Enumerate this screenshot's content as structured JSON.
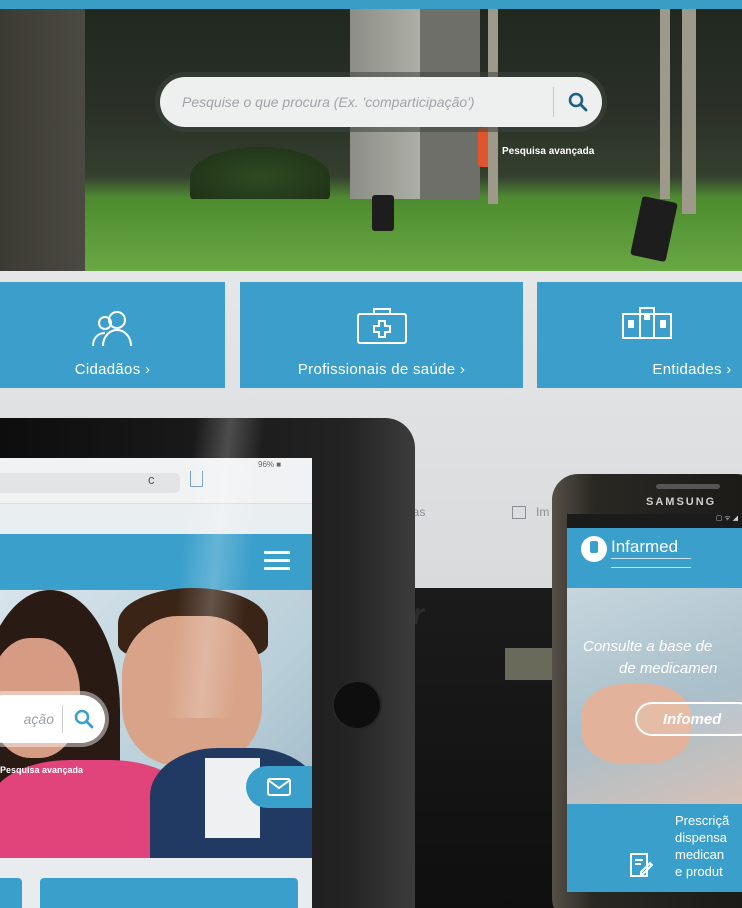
{
  "monitor": {
    "search": {
      "placeholder": "Pesquise o que procura (Ex. 'comparticipação')"
    },
    "advanced_search": "Pesquisa avançada",
    "cards": [
      {
        "label": "Cidadãos ›",
        "icon": "people-icon"
      },
      {
        "label": "Profissionais de saúde ›",
        "icon": "medical-kit-icon"
      },
      {
        "label": "Entidades ›",
        "icon": "building-icon"
      }
    ],
    "link_fragment_1": "cias",
    "link_fragment_2": "Im",
    "monitor_brand": "er"
  },
  "tablet": {
    "search_fragment": "ação",
    "advanced_search": "Pesquisa avançada",
    "battery_text": "96% ■"
  },
  "phone": {
    "brand": "SAMSUNG",
    "app_name": "Infarmed",
    "hero_line1": "Consulte a base de",
    "hero_line2": "de medicamen",
    "hero_button": "Infomed",
    "footer_lines": [
      "Prescriçã",
      "dispensa",
      "medican",
      "e produt"
    ]
  },
  "colors": {
    "accent": "#3b9fcb",
    "grass": "#5f9b3e"
  }
}
